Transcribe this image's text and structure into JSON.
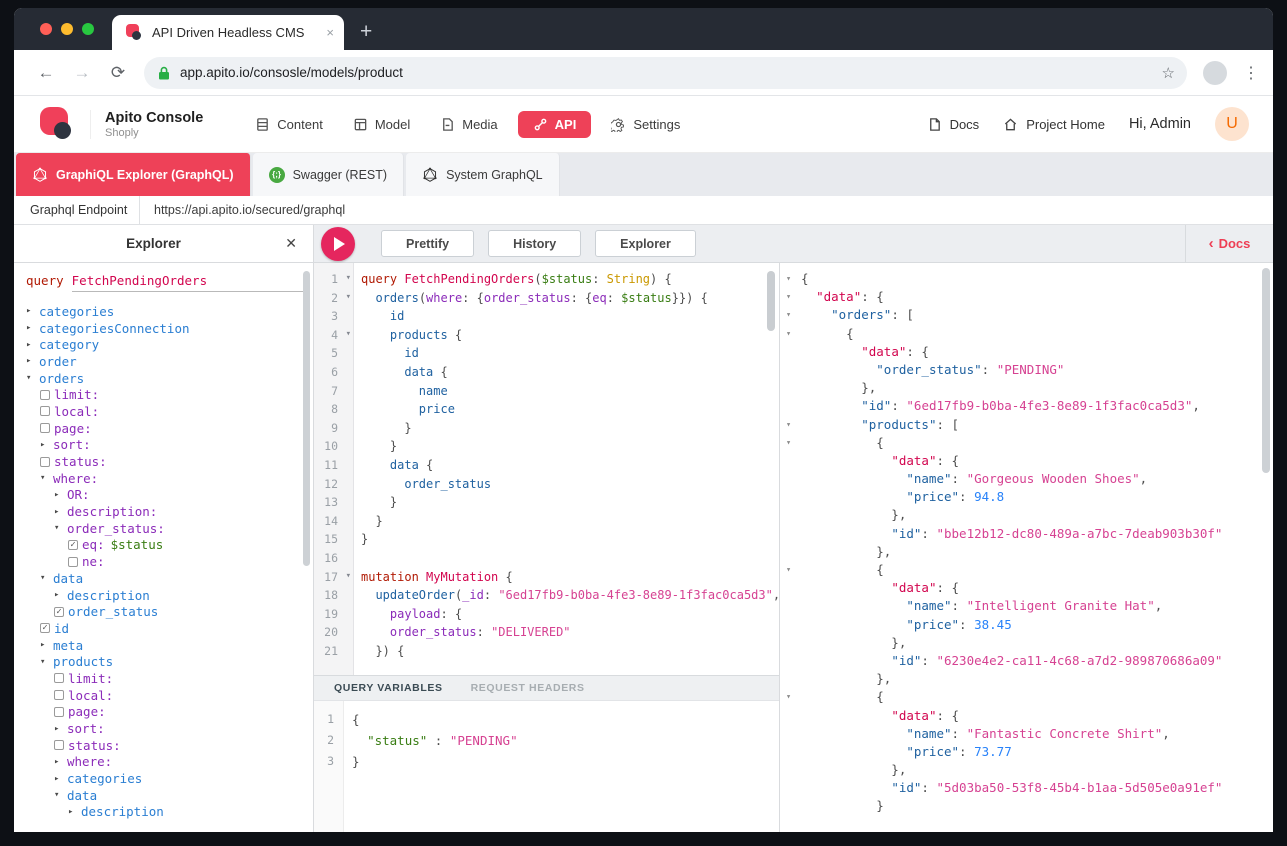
{
  "browser": {
    "tab_title": "API Driven Headless CMS",
    "tab_close": "×",
    "new_tab": "+",
    "url": "app.apito.io/consosle/models/product",
    "menu_dots": "⋮",
    "star": "☆",
    "back": "←",
    "forward": "→",
    "reload": "⟳"
  },
  "header": {
    "app_name": "Apito Console",
    "workspace": "Shoply",
    "nav": [
      {
        "label": "Content",
        "icon": "content",
        "active": false
      },
      {
        "label": "Model",
        "icon": "model",
        "active": false
      },
      {
        "label": "Media",
        "icon": "media",
        "active": false
      },
      {
        "label": "API",
        "icon": "api",
        "active": true
      },
      {
        "label": "Settings",
        "icon": "settings",
        "active": false
      }
    ],
    "links": [
      {
        "label": "Docs",
        "icon": "docs"
      },
      {
        "label": "Project Home",
        "icon": "home"
      }
    ],
    "greeting": "Hi, Admin",
    "avatar_letter": "U"
  },
  "api_tabs": [
    {
      "label": "GraphiQL Explorer (GraphQL)",
      "icon": "graphql",
      "active": true
    },
    {
      "label": "Swagger (REST)",
      "icon": "swagger",
      "active": false
    },
    {
      "label": "System GraphQL",
      "icon": "graphql-dark",
      "active": false
    }
  ],
  "endpoint": {
    "label": "Graphql Endpoint",
    "url": "https://api.apito.io/secured/graphql"
  },
  "toolbar": {
    "buttons": [
      "Prettify",
      "History",
      "Explorer"
    ],
    "docs_label": "Docs",
    "docs_chevron": "‹"
  },
  "explorer": {
    "title": "Explorer",
    "close": "✕",
    "query_keyword": "query",
    "query_name": "FetchPendingOrders",
    "tree": [
      {
        "i": 0,
        "a": "r",
        "c": "f",
        "t": "categories"
      },
      {
        "i": 0,
        "a": "r",
        "c": "f",
        "t": "categoriesConnection"
      },
      {
        "i": 0,
        "a": "r",
        "c": "f",
        "t": "category"
      },
      {
        "i": 0,
        "a": "r",
        "c": "f",
        "t": "order"
      },
      {
        "i": 0,
        "a": "d",
        "c": "f",
        "t": "orders"
      },
      {
        "i": 1,
        "cb": "u",
        "c": "a",
        "t": "limit:"
      },
      {
        "i": 1,
        "cb": "u",
        "c": "a",
        "t": "local:"
      },
      {
        "i": 1,
        "cb": "u",
        "c": "a",
        "t": "page:"
      },
      {
        "i": 1,
        "a": "r",
        "c": "a",
        "t": "sort:"
      },
      {
        "i": 1,
        "cb": "u",
        "c": "a",
        "t": "status:"
      },
      {
        "i": 1,
        "a": "d",
        "c": "a",
        "t": "where:"
      },
      {
        "i": 2,
        "a": "r",
        "c": "a",
        "t": "OR:"
      },
      {
        "i": 2,
        "a": "r",
        "c": "a",
        "t": "description:"
      },
      {
        "i": 2,
        "a": "d",
        "c": "a",
        "t": "order_status:"
      },
      {
        "i": 3,
        "cb": "c",
        "c": "a",
        "t": "eq:",
        "v": "$status"
      },
      {
        "i": 3,
        "cb": "u",
        "c": "a",
        "t": "ne:"
      },
      {
        "i": 1,
        "a": "d",
        "c": "f",
        "t": "data"
      },
      {
        "i": 2,
        "a": "r",
        "c": "f",
        "t": "description"
      },
      {
        "i": 2,
        "cb": "c",
        "c": "f",
        "t": "order_status"
      },
      {
        "i": 1,
        "cb": "c",
        "c": "f",
        "t": "id"
      },
      {
        "i": 1,
        "a": "r",
        "c": "f",
        "t": "meta"
      },
      {
        "i": 1,
        "a": "d",
        "c": "f",
        "t": "products"
      },
      {
        "i": 2,
        "cb": "u",
        "c": "a",
        "t": "limit:"
      },
      {
        "i": 2,
        "cb": "u",
        "c": "a",
        "t": "local:"
      },
      {
        "i": 2,
        "cb": "u",
        "c": "a",
        "t": "page:"
      },
      {
        "i": 2,
        "a": "r",
        "c": "a",
        "t": "sort:"
      },
      {
        "i": 2,
        "cb": "u",
        "c": "a",
        "t": "status:"
      },
      {
        "i": 2,
        "a": "r",
        "c": "a",
        "t": "where:"
      },
      {
        "i": 2,
        "a": "r",
        "c": "f",
        "t": "categories"
      },
      {
        "i": 2,
        "a": "d",
        "c": "f",
        "t": "data"
      },
      {
        "i": 3,
        "a": "r",
        "c": "f",
        "t": "description"
      }
    ]
  },
  "editor": {
    "lines": [
      {
        "f": 1,
        "t": [
          [
            "kw",
            "query"
          ],
          [
            "p",
            " "
          ],
          [
            "def",
            "FetchPendingOrders"
          ],
          [
            "p",
            "("
          ],
          [
            "var",
            "$status"
          ],
          [
            "p",
            ": "
          ],
          [
            "type",
            "String"
          ],
          [
            "p",
            ") {"
          ]
        ]
      },
      {
        "f": 1,
        "t": [
          [
            "p",
            "  "
          ],
          [
            "field",
            "orders"
          ],
          [
            "p",
            "("
          ],
          [
            "attr",
            "where"
          ],
          [
            "p",
            ": {"
          ],
          [
            "attr",
            "order_status"
          ],
          [
            "p",
            ": {"
          ],
          [
            "attr",
            "eq"
          ],
          [
            "p",
            ": "
          ],
          [
            "var",
            "$status"
          ],
          [
            "p",
            "}}) {"
          ]
        ]
      },
      {
        "t": [
          [
            "p",
            "    "
          ],
          [
            "field",
            "id"
          ]
        ]
      },
      {
        "f": 1,
        "t": [
          [
            "p",
            "    "
          ],
          [
            "field",
            "products"
          ],
          [
            "p",
            " {"
          ]
        ]
      },
      {
        "t": [
          [
            "p",
            "      "
          ],
          [
            "field",
            "id"
          ]
        ]
      },
      {
        "t": [
          [
            "p",
            "      "
          ],
          [
            "field",
            "data"
          ],
          [
            "p",
            " {"
          ]
        ]
      },
      {
        "t": [
          [
            "p",
            "        "
          ],
          [
            "field",
            "name"
          ]
        ]
      },
      {
        "t": [
          [
            "p",
            "        "
          ],
          [
            "field",
            "price"
          ]
        ]
      },
      {
        "t": [
          [
            "p",
            "      }"
          ]
        ]
      },
      {
        "t": [
          [
            "p",
            "    }"
          ]
        ]
      },
      {
        "t": [
          [
            "p",
            "    "
          ],
          [
            "field",
            "data"
          ],
          [
            "p",
            " {"
          ]
        ]
      },
      {
        "t": [
          [
            "p",
            "      "
          ],
          [
            "field",
            "order_status"
          ]
        ]
      },
      {
        "t": [
          [
            "p",
            "    }"
          ]
        ]
      },
      {
        "t": [
          [
            "p",
            "  }"
          ]
        ]
      },
      {
        "t": [
          [
            "p",
            "}"
          ]
        ]
      },
      {
        "t": []
      },
      {
        "f": 1,
        "t": [
          [
            "kw",
            "mutation"
          ],
          [
            "p",
            " "
          ],
          [
            "def",
            "MyMutation"
          ],
          [
            "p",
            " {"
          ]
        ]
      },
      {
        "t": [
          [
            "p",
            "  "
          ],
          [
            "field",
            "updateOrder"
          ],
          [
            "p",
            "("
          ],
          [
            "attr",
            "_id"
          ],
          [
            "p",
            ": "
          ],
          [
            "str",
            "\"6ed17fb9-b0ba-4fe3-8e89-1f3fac0ca5d3\""
          ],
          [
            "p",
            ","
          ]
        ]
      },
      {
        "t": [
          [
            "p",
            "    "
          ],
          [
            "attr",
            "payload"
          ],
          [
            "p",
            ": {"
          ]
        ]
      },
      {
        "t": [
          [
            "p",
            "    "
          ],
          [
            "attr",
            "order_status"
          ],
          [
            "p",
            ": "
          ],
          [
            "str",
            "\"DELIVERED\""
          ]
        ]
      },
      {
        "t": [
          [
            "p",
            "  }) {"
          ]
        ]
      }
    ]
  },
  "variables_panel": {
    "tabs": [
      "QUERY VARIABLES",
      "REQUEST HEADERS"
    ],
    "lines": [
      {
        "t": [
          [
            "p",
            "{"
          ]
        ]
      },
      {
        "t": [
          [
            "p",
            "  "
          ],
          [
            "vkey",
            "\"status\""
          ],
          [
            "p",
            " : "
          ],
          [
            "str",
            "\"PENDING\""
          ]
        ]
      },
      {
        "t": [
          [
            "p",
            "}"
          ]
        ]
      }
    ]
  },
  "results": {
    "lines": [
      {
        "f": 1,
        "t": [
          [
            "p",
            "{"
          ]
        ]
      },
      {
        "f": 1,
        "t": [
          [
            "p",
            "  "
          ],
          [
            "dkey",
            "\"data\""
          ],
          [
            "p",
            ": {"
          ]
        ]
      },
      {
        "f": 1,
        "t": [
          [
            "p",
            "    "
          ],
          [
            "key",
            "\"orders\""
          ],
          [
            "p",
            ": ["
          ]
        ]
      },
      {
        "f": 1,
        "t": [
          [
            "p",
            "      {"
          ]
        ]
      },
      {
        "t": [
          [
            "p",
            "        "
          ],
          [
            "dkey",
            "\"data\""
          ],
          [
            "p",
            ": {"
          ]
        ]
      },
      {
        "t": [
          [
            "p",
            "          "
          ],
          [
            "key",
            "\"order_status\""
          ],
          [
            "p",
            ": "
          ],
          [
            "str",
            "\"PENDING\""
          ]
        ]
      },
      {
        "t": [
          [
            "p",
            "        },"
          ]
        ]
      },
      {
        "t": [
          [
            "p",
            "        "
          ],
          [
            "key",
            "\"id\""
          ],
          [
            "p",
            ": "
          ],
          [
            "str",
            "\"6ed17fb9-b0ba-4fe3-8e89-1f3fac0ca5d3\""
          ],
          [
            "p",
            ","
          ]
        ]
      },
      {
        "f": 1,
        "t": [
          [
            "p",
            "        "
          ],
          [
            "key",
            "\"products\""
          ],
          [
            "p",
            ": ["
          ]
        ]
      },
      {
        "f": 1,
        "t": [
          [
            "p",
            "          {"
          ]
        ]
      },
      {
        "t": [
          [
            "p",
            "            "
          ],
          [
            "dkey",
            "\"data\""
          ],
          [
            "p",
            ": {"
          ]
        ]
      },
      {
        "t": [
          [
            "p",
            "              "
          ],
          [
            "key",
            "\"name\""
          ],
          [
            "p",
            ": "
          ],
          [
            "str",
            "\"Gorgeous Wooden Shoes\""
          ],
          [
            "p",
            ","
          ]
        ]
      },
      {
        "t": [
          [
            "p",
            "              "
          ],
          [
            "key",
            "\"price\""
          ],
          [
            "p",
            ": "
          ],
          [
            "num",
            "94.8"
          ]
        ]
      },
      {
        "t": [
          [
            "p",
            "            },"
          ]
        ]
      },
      {
        "t": [
          [
            "p",
            "            "
          ],
          [
            "key",
            "\"id\""
          ],
          [
            "p",
            ": "
          ],
          [
            "str",
            "\"bbe12b12-dc80-489a-a7bc-7deab903b30f\""
          ]
        ]
      },
      {
        "t": [
          [
            "p",
            "          },"
          ]
        ]
      },
      {
        "f": 1,
        "t": [
          [
            "p",
            "          {"
          ]
        ]
      },
      {
        "t": [
          [
            "p",
            "            "
          ],
          [
            "dkey",
            "\"data\""
          ],
          [
            "p",
            ": {"
          ]
        ]
      },
      {
        "t": [
          [
            "p",
            "              "
          ],
          [
            "key",
            "\"name\""
          ],
          [
            "p",
            ": "
          ],
          [
            "str",
            "\"Intelligent Granite Hat\""
          ],
          [
            "p",
            ","
          ]
        ]
      },
      {
        "t": [
          [
            "p",
            "              "
          ],
          [
            "key",
            "\"price\""
          ],
          [
            "p",
            ": "
          ],
          [
            "num",
            "38.45"
          ]
        ]
      },
      {
        "t": [
          [
            "p",
            "            },"
          ]
        ]
      },
      {
        "t": [
          [
            "p",
            "            "
          ],
          [
            "key",
            "\"id\""
          ],
          [
            "p",
            ": "
          ],
          [
            "str",
            "\"6230e4e2-ca11-4c68-a7d2-989870686a09\""
          ]
        ]
      },
      {
        "t": [
          [
            "p",
            "          },"
          ]
        ]
      },
      {
        "f": 1,
        "t": [
          [
            "p",
            "          {"
          ]
        ]
      },
      {
        "t": [
          [
            "p",
            "            "
          ],
          [
            "dkey",
            "\"data\""
          ],
          [
            "p",
            ": {"
          ]
        ]
      },
      {
        "t": [
          [
            "p",
            "              "
          ],
          [
            "key",
            "\"name\""
          ],
          [
            "p",
            ": "
          ],
          [
            "str",
            "\"Fantastic Concrete Shirt\""
          ],
          [
            "p",
            ","
          ]
        ]
      },
      {
        "t": [
          [
            "p",
            "              "
          ],
          [
            "key",
            "\"price\""
          ],
          [
            "p",
            ": "
          ],
          [
            "num",
            "73.77"
          ]
        ]
      },
      {
        "t": [
          [
            "p",
            "            },"
          ]
        ]
      },
      {
        "t": [
          [
            "p",
            "            "
          ],
          [
            "key",
            "\"id\""
          ],
          [
            "p",
            ": "
          ],
          [
            "str",
            "\"5d03ba50-53f8-45b4-b1aa-5d505e0a91ef\""
          ]
        ]
      },
      {
        "t": [
          [
            "p",
            "          }"
          ]
        ]
      }
    ]
  },
  "colors": {
    "accent": "#EE4158",
    "play": "#E5265E",
    "avatar_bg": "#FDE3CF",
    "avatar_fg": "#F56A00"
  }
}
